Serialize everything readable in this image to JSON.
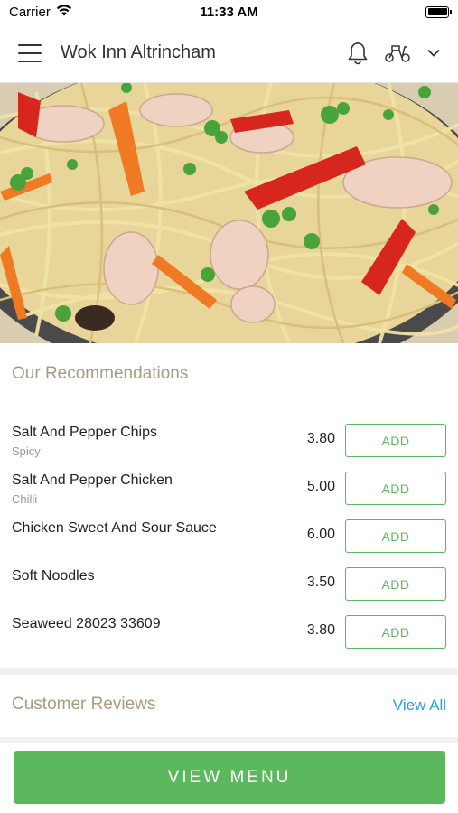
{
  "status_bar": {
    "carrier": "Carrier",
    "time": "11:33 AM"
  },
  "header": {
    "title": "Wok Inn Altrincham",
    "icons": [
      "menu-icon",
      "bell-icon",
      "scooter-icon",
      "chevron-down-icon"
    ]
  },
  "hero": {
    "description_icon": "noodle-dish-image"
  },
  "recommendations": {
    "title": "Our Recommendations",
    "items": [
      {
        "name": "Salt And Pepper Chips",
        "subtitle": "Spicy",
        "price": "3.80",
        "button": "ADD"
      },
      {
        "name": "Salt And Pepper Chicken",
        "subtitle": "Chilli",
        "price": "5.00",
        "button": "ADD"
      },
      {
        "name": "Chicken Sweet And Sour Sauce",
        "subtitle": "",
        "price": "6.00",
        "button": "ADD"
      },
      {
        "name": "Soft Noodles",
        "subtitle": "",
        "price": "3.50",
        "button": "ADD"
      },
      {
        "name": "Seaweed 28023 33609",
        "subtitle": "",
        "price": "3.80",
        "button": "ADD"
      }
    ]
  },
  "reviews": {
    "title": "Customer Reviews",
    "view_all": "View All"
  },
  "footer": {
    "view_menu": "VIEW MENU"
  },
  "colors": {
    "accent_green": "#5cb85c",
    "section_title": "#a99b7e",
    "link_blue": "#2a9fd6"
  }
}
